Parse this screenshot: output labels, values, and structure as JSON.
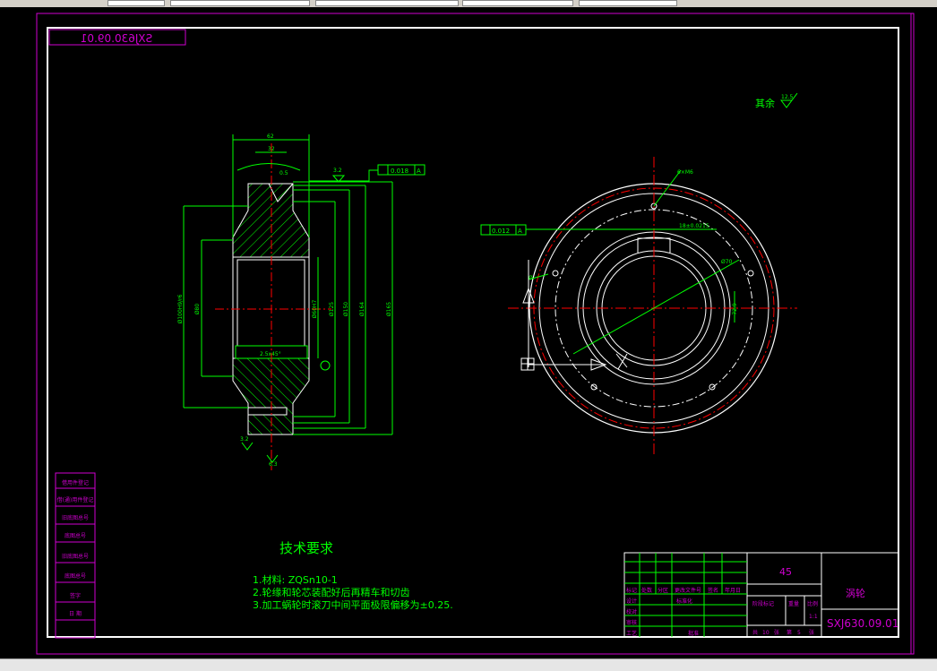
{
  "window": {
    "tabs": [
      "",
      "",
      "",
      "",
      ""
    ]
  },
  "drawing": {
    "mirrored_code": "SXJ630.09.01",
    "roughness_note": "其余",
    "roughness_value": "12.5",
    "tech_title": "技术要求",
    "tech_requirements": [
      "1.材料: ZQSn10-1",
      "2.轮缘和轮芯装配好后再精车和切齿",
      "3.加工蜗轮时滚刀中间平面极限偏移为±0.25."
    ],
    "dims_section": {
      "top_width": "62",
      "inner_width": "32",
      "small_a": "0.5",
      "tol_frame": "0.018",
      "datum": "A",
      "roughness_a": "3.2",
      "chamfer": "2.5x45°",
      "d1": "Ø100H9/r6",
      "d2": "Ø80",
      "d3": "Ø60H7",
      "d4": "Ø125",
      "d5": "Ø150",
      "d6": "Ø164",
      "d7": "Ø165",
      "roughness_b": "3.2",
      "roughness_c": "6.3"
    },
    "dims_face": {
      "holes": "6×M6",
      "tol_frame": "0.012",
      "datum": "A",
      "keyway": "18±0.0215",
      "bore": "Ø70",
      "dim_side": "72.9",
      "roughness": "Ø"
    },
    "side_labels": [
      "借用件登记",
      "旧底图总号",
      "底图总号",
      "签  字",
      "日  期",
      "借(通)用件登记",
      "旧底图总号",
      "底图总号",
      "签字"
    ],
    "title_block": {
      "material": "45",
      "part_name": "涡轮",
      "code": "SXJ630.09.01",
      "scale": "1:1",
      "headers": [
        "标记",
        "处数",
        "分区",
        "更改文件号",
        "签名",
        "年月日"
      ],
      "rows": [
        "设计",
        "校对",
        "审核",
        "工艺",
        "标准化",
        "批准"
      ],
      "stage_labels": [
        "阶段标记",
        "重量",
        "比例"
      ],
      "sheet_info": [
        "共",
        "10",
        "张",
        "第",
        "5",
        "张"
      ]
    }
  }
}
